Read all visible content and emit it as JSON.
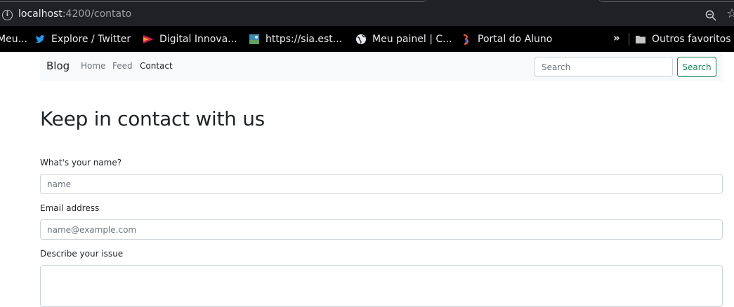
{
  "browser": {
    "url_host": "localhost",
    "url_path": ":4200/contato",
    "bookmarks": [
      {
        "label": "Meu...",
        "icon": "bookmark-icon"
      },
      {
        "label": "Explore / Twitter",
        "icon": "twitter-icon"
      },
      {
        "label": "Digital Innova...",
        "icon": "dio-icon"
      },
      {
        "label": "https://sia.est...",
        "icon": "globe-image-icon"
      },
      {
        "label": "Meu painel | C...",
        "icon": "globe-icon"
      },
      {
        "label": "Portal do Aluno",
        "icon": "portal-icon"
      }
    ],
    "more_label": "»",
    "other_favorites": "Outros favoritos"
  },
  "navbar": {
    "brand": "Blog",
    "links": [
      "Home",
      "Feed",
      "Contact"
    ],
    "search_placeholder": "Search",
    "search_button": "Search"
  },
  "main": {
    "title": "Keep in contact with us",
    "form": {
      "name_label": "What's your name?",
      "name_placeholder": "name",
      "email_label": "Email address",
      "email_placeholder": "name@example.com",
      "issue_label": "Describe your issue",
      "issue_value": ""
    }
  },
  "colors": {
    "accent_success": "#198754",
    "navbar_bg": "#f8f9fa",
    "chrome_bg": "#202124"
  }
}
